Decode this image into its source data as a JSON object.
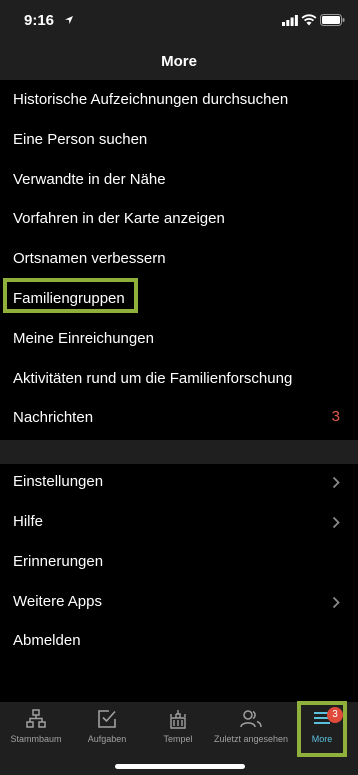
{
  "status_bar": {
    "time": "9:16"
  },
  "header": {
    "title": "More"
  },
  "menu_primary": [
    {
      "label": "Historische Aufzeichnungen durchsuchen"
    },
    {
      "label": "Eine Person suchen"
    },
    {
      "label": "Verwandte in der Nähe"
    },
    {
      "label": "Vorfahren in der Karte anzeigen"
    },
    {
      "label": "Ortsnamen verbessern"
    },
    {
      "label": "Familiengruppen"
    },
    {
      "label": "Meine Einreichungen"
    },
    {
      "label": "Aktivitäten rund um die Familienforschung"
    },
    {
      "label": "Nachrichten",
      "badge": "3"
    }
  ],
  "menu_secondary": [
    {
      "label": "Einstellungen",
      "chevron": true
    },
    {
      "label": "Hilfe",
      "chevron": true
    },
    {
      "label": "Erinnerungen",
      "chevron": false
    },
    {
      "label": "Weitere Apps",
      "chevron": true
    },
    {
      "label": "Abmelden",
      "chevron": false
    }
  ],
  "tab_bar": {
    "tabs": [
      {
        "label": "Stammbaum",
        "icon": "tree-icon"
      },
      {
        "label": "Aufgaben",
        "icon": "checklist-icon"
      },
      {
        "label": "Tempel",
        "icon": "temple-icon"
      },
      {
        "label": "Zuletzt angesehen",
        "icon": "people-icon"
      },
      {
        "label": "More",
        "icon": "menu-icon",
        "active": true,
        "badge": "3"
      }
    ]
  },
  "colors": {
    "accent": "#5bc0de",
    "badge": "#e04a3a",
    "highlight": "#8fb03a",
    "background": "#000000",
    "bar": "#1f1f1f"
  }
}
